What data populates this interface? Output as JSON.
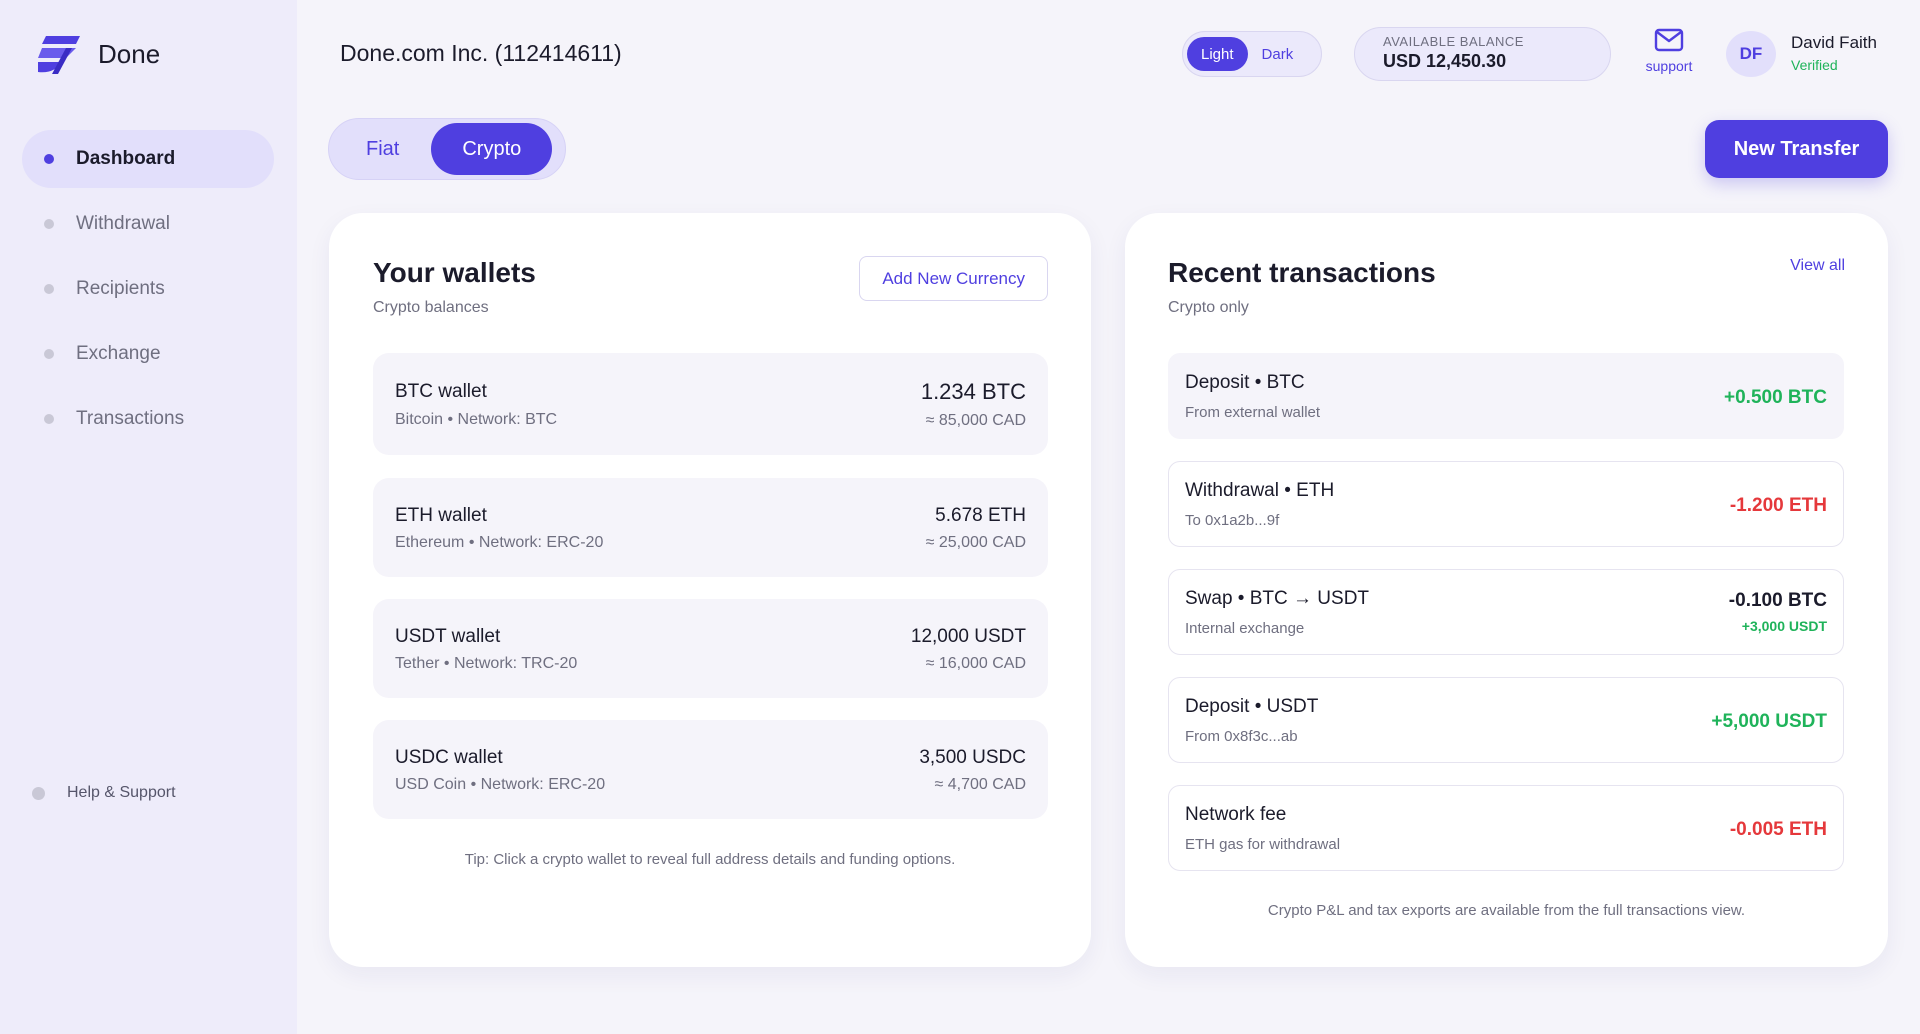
{
  "app": {
    "name": "Done",
    "company": "Done.com Inc. (112414611)"
  },
  "sidebar": {
    "items": [
      {
        "label": "Dashboard",
        "active": true
      },
      {
        "label": "Withdrawal",
        "active": false
      },
      {
        "label": "Recipients",
        "active": false
      },
      {
        "label": "Exchange",
        "active": false
      },
      {
        "label": "Transactions",
        "active": false
      }
    ],
    "help": "Help & Support"
  },
  "header": {
    "theme": {
      "light": "Light",
      "dark": "Dark",
      "selected": "Light"
    },
    "balance": {
      "label": "AVAILABLE BALANCE",
      "value": "USD 12,450.30"
    },
    "support": "support",
    "user": {
      "initials": "DF",
      "name": "David Faith",
      "status": "Verified"
    }
  },
  "tabs": {
    "fiat": "Fiat",
    "crypto": "Crypto",
    "selected": "Crypto"
  },
  "new_transfer": "New Transfer",
  "wallets": {
    "title": "Your wallets",
    "subtitle": "Crypto balances",
    "add_button": "Add New Currency",
    "items": [
      {
        "name": "BTC wallet",
        "meta": "Bitcoin • Network: BTC",
        "amount": "1.234 BTC",
        "fiat": "≈ 85,000 CAD"
      },
      {
        "name": "ETH wallet",
        "meta": "Ethereum • Network: ERC-20",
        "amount": "5.678 ETH",
        "fiat": "≈ 25,000 CAD"
      },
      {
        "name": "USDT wallet",
        "meta": "Tether • Network: TRC-20",
        "amount": "12,000 USDT",
        "fiat": "≈ 16,000 CAD"
      },
      {
        "name": "USDC wallet",
        "meta": "USD Coin • Network: ERC-20",
        "amount": "3,500 USDC",
        "fiat": "≈ 4,700 CAD"
      }
    ],
    "tip": "Tip: Click a crypto wallet to reveal full address details and funding options."
  },
  "transactions": {
    "title": "Recent transactions",
    "subtitle": "Crypto only",
    "view_all": "View all",
    "items": [
      {
        "title": "Deposit • BTC",
        "sub": "From external wallet",
        "amount": "+0.500 BTC"
      },
      {
        "title": "Withdrawal • ETH",
        "sub": "To 0x1a2b...9f",
        "amount": "-1.200 ETH"
      },
      {
        "title": "Swap • BTC → USDT",
        "sub": "Internal exchange",
        "amount": "-0.100 BTC",
        "amount2": "+3,000 USDT"
      },
      {
        "title": "Deposit • USDT",
        "sub": "From 0x8f3c...ab",
        "amount": "+5,000 USDT"
      },
      {
        "title": "Network fee",
        "sub": "ETH gas for withdrawal",
        "amount": "-0.005 ETH"
      }
    ],
    "footnote": "Crypto P&L and tax exports are available from the full transactions view."
  },
  "colors": {
    "accent": "#4f3fe0",
    "positive": "#1fb35a",
    "negative": "#e5383b",
    "sidebar": "#eeecfa"
  },
  "icons": {
    "logo": "done-logo-icon",
    "support": "mail-icon"
  }
}
